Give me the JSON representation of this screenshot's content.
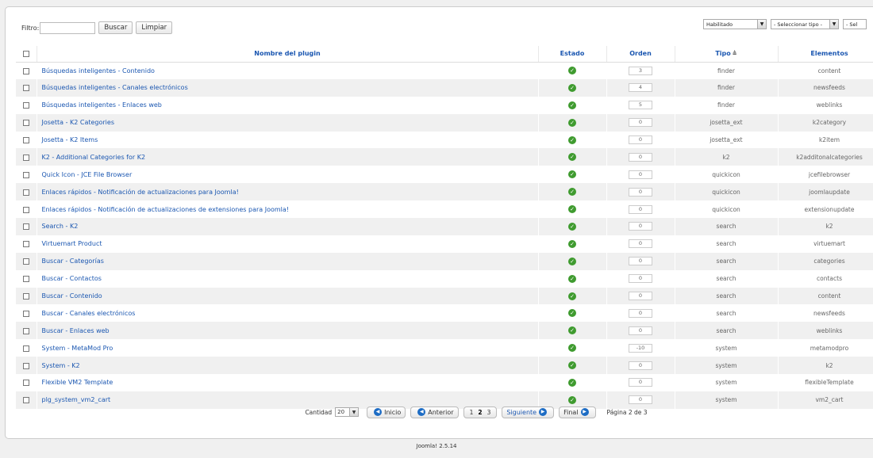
{
  "toolbar": {
    "filter_label": "Filtro:",
    "filter_value": "",
    "search_button": "Buscar",
    "clear_button": "Limpiar",
    "state_select": "Habilitado",
    "type_select": "- Seleccionar tipo -",
    "extra_select": "- Sel"
  },
  "columns": {
    "name": "Nombre del plugin",
    "state": "Estado",
    "order": "Orden",
    "type": "Tipo",
    "elements": "Elementos"
  },
  "rows": [
    {
      "name": "Búsquedas inteligentes - Contenido",
      "order": "3",
      "type": "finder",
      "element": "content"
    },
    {
      "name": "Búsquedas inteligentes - Canales electrónicos",
      "order": "4",
      "type": "finder",
      "element": "newsfeeds"
    },
    {
      "name": "Búsquedas inteligentes - Enlaces web",
      "order": "5",
      "type": "finder",
      "element": "weblinks"
    },
    {
      "name": "Josetta - K2 Categories",
      "order": "0",
      "type": "josetta_ext",
      "element": "k2category"
    },
    {
      "name": "Josetta - K2 Items",
      "order": "0",
      "type": "josetta_ext",
      "element": "k2item"
    },
    {
      "name": "K2 - Additional Categories for K2",
      "order": "0",
      "type": "k2",
      "element": "k2additonalcategories"
    },
    {
      "name": "Quick Icon - JCE File Browser",
      "order": "0",
      "type": "quickicon",
      "element": "jcefilebrowser"
    },
    {
      "name": "Enlaces rápidos - Notificación de actualizaciones para Joomla!",
      "order": "0",
      "type": "quickicon",
      "element": "joomlaupdate"
    },
    {
      "name": "Enlaces rápidos - Notificación de actualizaciones de extensiones para Joomla!",
      "order": "0",
      "type": "quickicon",
      "element": "extensionupdate"
    },
    {
      "name": "Search - K2",
      "order": "0",
      "type": "search",
      "element": "k2"
    },
    {
      "name": "Virtuemart Product",
      "order": "0",
      "type": "search",
      "element": "virtuemart"
    },
    {
      "name": "Buscar - Categorías",
      "order": "0",
      "type": "search",
      "element": "categories"
    },
    {
      "name": "Buscar - Contactos",
      "order": "0",
      "type": "search",
      "element": "contacts"
    },
    {
      "name": "Buscar - Contenido",
      "order": "0",
      "type": "search",
      "element": "content"
    },
    {
      "name": "Buscar - Canales electrónicos",
      "order": "0",
      "type": "search",
      "element": "newsfeeds"
    },
    {
      "name": "Buscar - Enlaces web",
      "order": "0",
      "type": "search",
      "element": "weblinks"
    },
    {
      "name": "System - MetaMod Pro",
      "order": "-10",
      "type": "system",
      "element": "metamodpro"
    },
    {
      "name": "System - K2",
      "order": "0",
      "type": "system",
      "element": "k2"
    },
    {
      "name": "Flexible VM2 Template",
      "order": "0",
      "type": "system",
      "element": "flexibleTemplate"
    },
    {
      "name": "plg_system_vm2_cart",
      "order": "0",
      "type": "system",
      "element": "vm2_cart"
    }
  ],
  "pagination": {
    "limit_label": "Cantidad",
    "limit_value": "20",
    "start": "Inicio",
    "prev": "Anterior",
    "pages": [
      "1",
      "2",
      "3"
    ],
    "current_page": "2",
    "next": "Siguiente",
    "end": "Final",
    "info": "Página 2 de 3"
  },
  "footer": "Joomla! 2.5.14",
  "colors": {
    "link": "#1b57b1",
    "enabled": "#3f9b2f"
  }
}
